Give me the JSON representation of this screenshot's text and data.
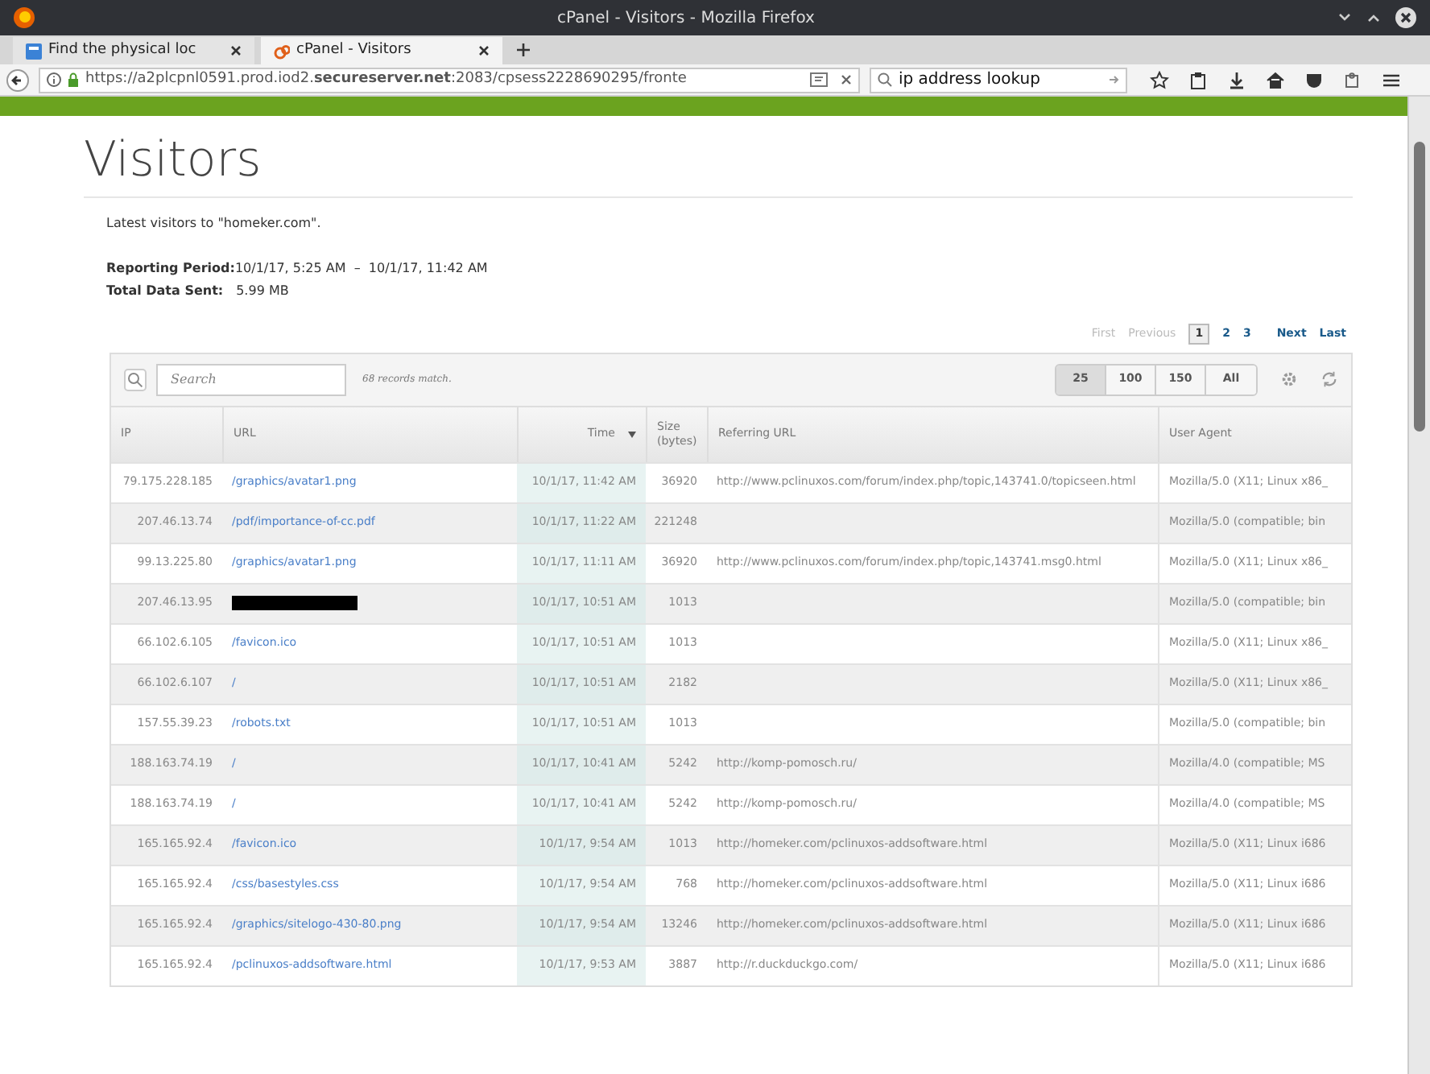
{
  "window": {
    "title": "cPanel - Visitors - Mozilla Firefox"
  },
  "tabs": [
    {
      "label": "Find the physical loc",
      "selected": false
    },
    {
      "label": "cPanel - Visitors",
      "selected": true
    }
  ],
  "address_bar": {
    "url": "https://a2plcpnl0591.prod.iod2.**secureserver.net**:2083/cpsess2228690295/fronte"
  },
  "search_field": {
    "value": "ip address lookup"
  },
  "page": {
    "title": "Visitors",
    "intro": "Latest visitors to \"homeker.com\".",
    "reporting_period_label": "Reporting Period:",
    "reporting_period": "10/1/17, 5:25 AM  –  10/1/17, 11:42 AM",
    "total_label": "Total Data Sent:",
    "total": "5.99 MB"
  },
  "pagination": [
    {
      "label": "First",
      "kind": "nav",
      "disabled": true,
      "selected": false
    },
    {
      "label": "Previous",
      "kind": "nav",
      "disabled": true,
      "selected": false
    },
    {
      "label": "1",
      "kind": "page",
      "disabled": false,
      "selected": true
    },
    {
      "label": "2",
      "kind": "page",
      "disabled": false,
      "selected": false
    },
    {
      "label": "3",
      "kind": "page",
      "disabled": false,
      "selected": false
    },
    {
      "label": "Next",
      "kind": "nav",
      "disabled": false,
      "selected": false
    },
    {
      "label": "Last",
      "kind": "nav",
      "disabled": false,
      "selected": false
    }
  ],
  "table": {
    "search_placeholder": "Search",
    "match_count": "68 records match.",
    "page_sizes": [
      {
        "label": "25",
        "selected": true
      },
      {
        "label": "100",
        "selected": false
      },
      {
        "label": "150",
        "selected": false
      },
      {
        "label": "All",
        "selected": false
      }
    ],
    "columns": [
      {
        "label": "IP",
        "sorted": false
      },
      {
        "label": "URL",
        "sorted": false
      },
      {
        "label": "Time",
        "sorted": true
      },
      {
        "label": "Size (bytes)",
        "sorted": false
      },
      {
        "label": "Referring URL",
        "sorted": false
      },
      {
        "label": "User Agent",
        "sorted": false
      }
    ],
    "rows": [
      {
        "ip": "79.175.228.185",
        "url": "/graphics/avatar1.png",
        "url_redacted": false,
        "time": "10/1/17, 11:42 AM",
        "size": "36920",
        "referrer": "http://www.pclinuxos.com/forum/index.php/topic,143741.0/topicseen.html",
        "agent": "Mozilla/5.0 (X11; Linux x86_"
      },
      {
        "ip": "207.46.13.74",
        "url": "/pdf/importance-of-cc.pdf",
        "url_redacted": false,
        "time": "10/1/17, 11:22 AM",
        "size": "221248",
        "referrer": "",
        "agent": "Mozilla/5.0 (compatible; bin"
      },
      {
        "ip": "99.13.225.80",
        "url": "/graphics/avatar1.png",
        "url_redacted": false,
        "time": "10/1/17, 11:11 AM",
        "size": "36920",
        "referrer": "http://www.pclinuxos.com/forum/index.php/topic,143741.msg0.html",
        "agent": "Mozilla/5.0 (X11; Linux x86_"
      },
      {
        "ip": "207.46.13.95",
        "url": "",
        "url_redacted": true,
        "time": "10/1/17, 10:51 AM",
        "size": "1013",
        "referrer": "",
        "agent": "Mozilla/5.0 (compatible; bin"
      },
      {
        "ip": "66.102.6.105",
        "url": "/favicon.ico",
        "url_redacted": false,
        "time": "10/1/17, 10:51 AM",
        "size": "1013",
        "referrer": "",
        "agent": "Mozilla/5.0 (X11; Linux x86_"
      },
      {
        "ip": "66.102.6.107",
        "url": "/",
        "url_redacted": false,
        "time": "10/1/17, 10:51 AM",
        "size": "2182",
        "referrer": "",
        "agent": "Mozilla/5.0 (X11; Linux x86_"
      },
      {
        "ip": "157.55.39.23",
        "url": "/robots.txt",
        "url_redacted": false,
        "time": "10/1/17, 10:51 AM",
        "size": "1013",
        "referrer": "",
        "agent": "Mozilla/5.0 (compatible; bin"
      },
      {
        "ip": "188.163.74.19",
        "url": "/",
        "url_redacted": false,
        "time": "10/1/17, 10:41 AM",
        "size": "5242",
        "referrer": "http://komp-pomosch.ru/",
        "agent": "Mozilla/4.0 (compatible; MS"
      },
      {
        "ip": "188.163.74.19",
        "url": "/",
        "url_redacted": false,
        "time": "10/1/17, 10:41 AM",
        "size": "5242",
        "referrer": "http://komp-pomosch.ru/",
        "agent": "Mozilla/4.0 (compatible; MS"
      },
      {
        "ip": "165.165.92.4",
        "url": "/favicon.ico",
        "url_redacted": false,
        "time": "10/1/17, 9:54 AM",
        "size": "1013",
        "referrer": "http://homeker.com/pclinuxos-addsoftware.html",
        "agent": "Mozilla/5.0 (X11; Linux i686"
      },
      {
        "ip": "165.165.92.4",
        "url": "/css/basestyles.css",
        "url_redacted": false,
        "time": "10/1/17, 9:54 AM",
        "size": "768",
        "referrer": "http://homeker.com/pclinuxos-addsoftware.html",
        "agent": "Mozilla/5.0 (X11; Linux i686"
      },
      {
        "ip": "165.165.92.4",
        "url": "/graphics/sitelogo-430-80.png",
        "url_redacted": false,
        "time": "10/1/17, 9:54 AM",
        "size": "13246",
        "referrer": "http://homeker.com/pclinuxos-addsoftware.html",
        "agent": "Mozilla/5.0 (X11; Linux i686"
      },
      {
        "ip": "165.165.92.4",
        "url": "/pclinuxos-addsoftware.html",
        "url_redacted": false,
        "time": "10/1/17, 9:53 AM",
        "size": "3887",
        "referrer": "http://r.duckduckgo.com/",
        "agent": "Mozilla/5.0 (X11; Linux i686"
      }
    ]
  }
}
